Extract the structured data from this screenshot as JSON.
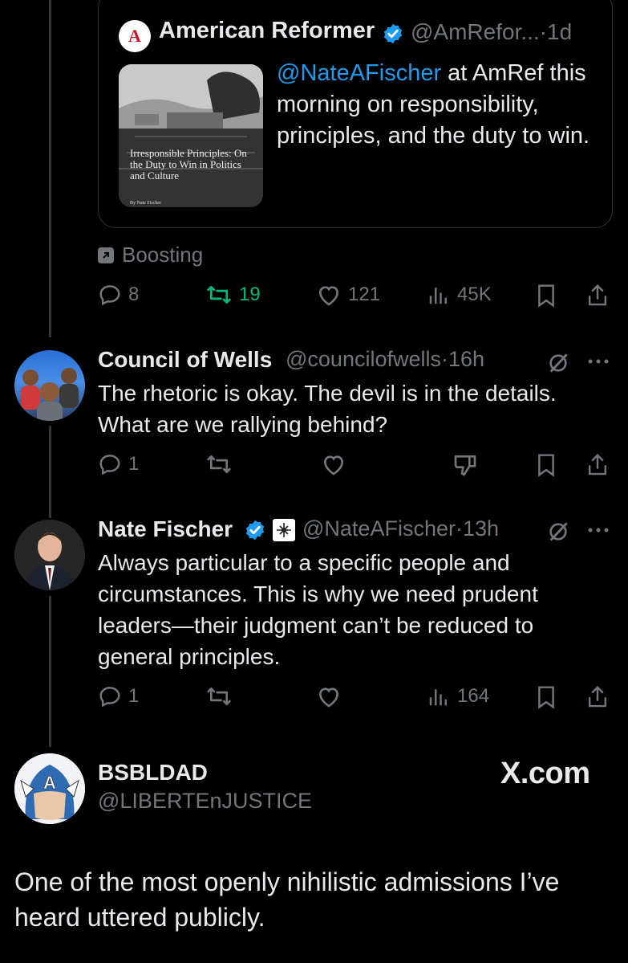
{
  "quoted_post": {
    "account_name": "American Reformer",
    "logo_letter": "A",
    "handle_time": "@AmRefor...·1d",
    "thumbnail_title": "Irresponsible Principles: On the Duty to Win in Politics and Culture",
    "thumbnail_byline": "By Nate Fischer",
    "mention": "@NateAFischer",
    "text": " at AmRef this morning on responsibility, principles, and the duty to win."
  },
  "boost_label": "Boosting",
  "post1_stats": {
    "replies": "8",
    "reposts": "19",
    "likes": "121",
    "views": "45K"
  },
  "reply1": {
    "name": "Council of Wells",
    "handle_time": "@councilofwells·16h",
    "text": "The rhetoric is okay. The devil is in the details. What are we rallying behind?",
    "replies": "1"
  },
  "reply2": {
    "name": "Nate Fischer",
    "handle_time": "@NateAFischer·13h",
    "text": "Always particular to a specific people and circumstances. This is why we need prudent leaders—their judgment can’t be reduced to general principles.",
    "replies": "1",
    "views": "164"
  },
  "quoter": {
    "name": "BSBLDAD",
    "handle": "@LIBERTEnJUSTICE",
    "watermark": "X.com",
    "avatar_letter": "A",
    "text": "One of the most openly nihilistic admissions I’ve heard uttered publicly."
  },
  "colors": {
    "accent": "#1d9bf0",
    "repost_active": "#00ba7c",
    "muted": "#71767b",
    "verified": "#1d9bf0"
  },
  "icons": [
    "reply-icon",
    "repost-icon",
    "like-icon",
    "views-icon",
    "bookmark-icon",
    "share-icon",
    "dislike-icon",
    "grok-icon",
    "more-icon",
    "verified-icon",
    "affiliate-badge-icon",
    "boost-icon"
  ]
}
